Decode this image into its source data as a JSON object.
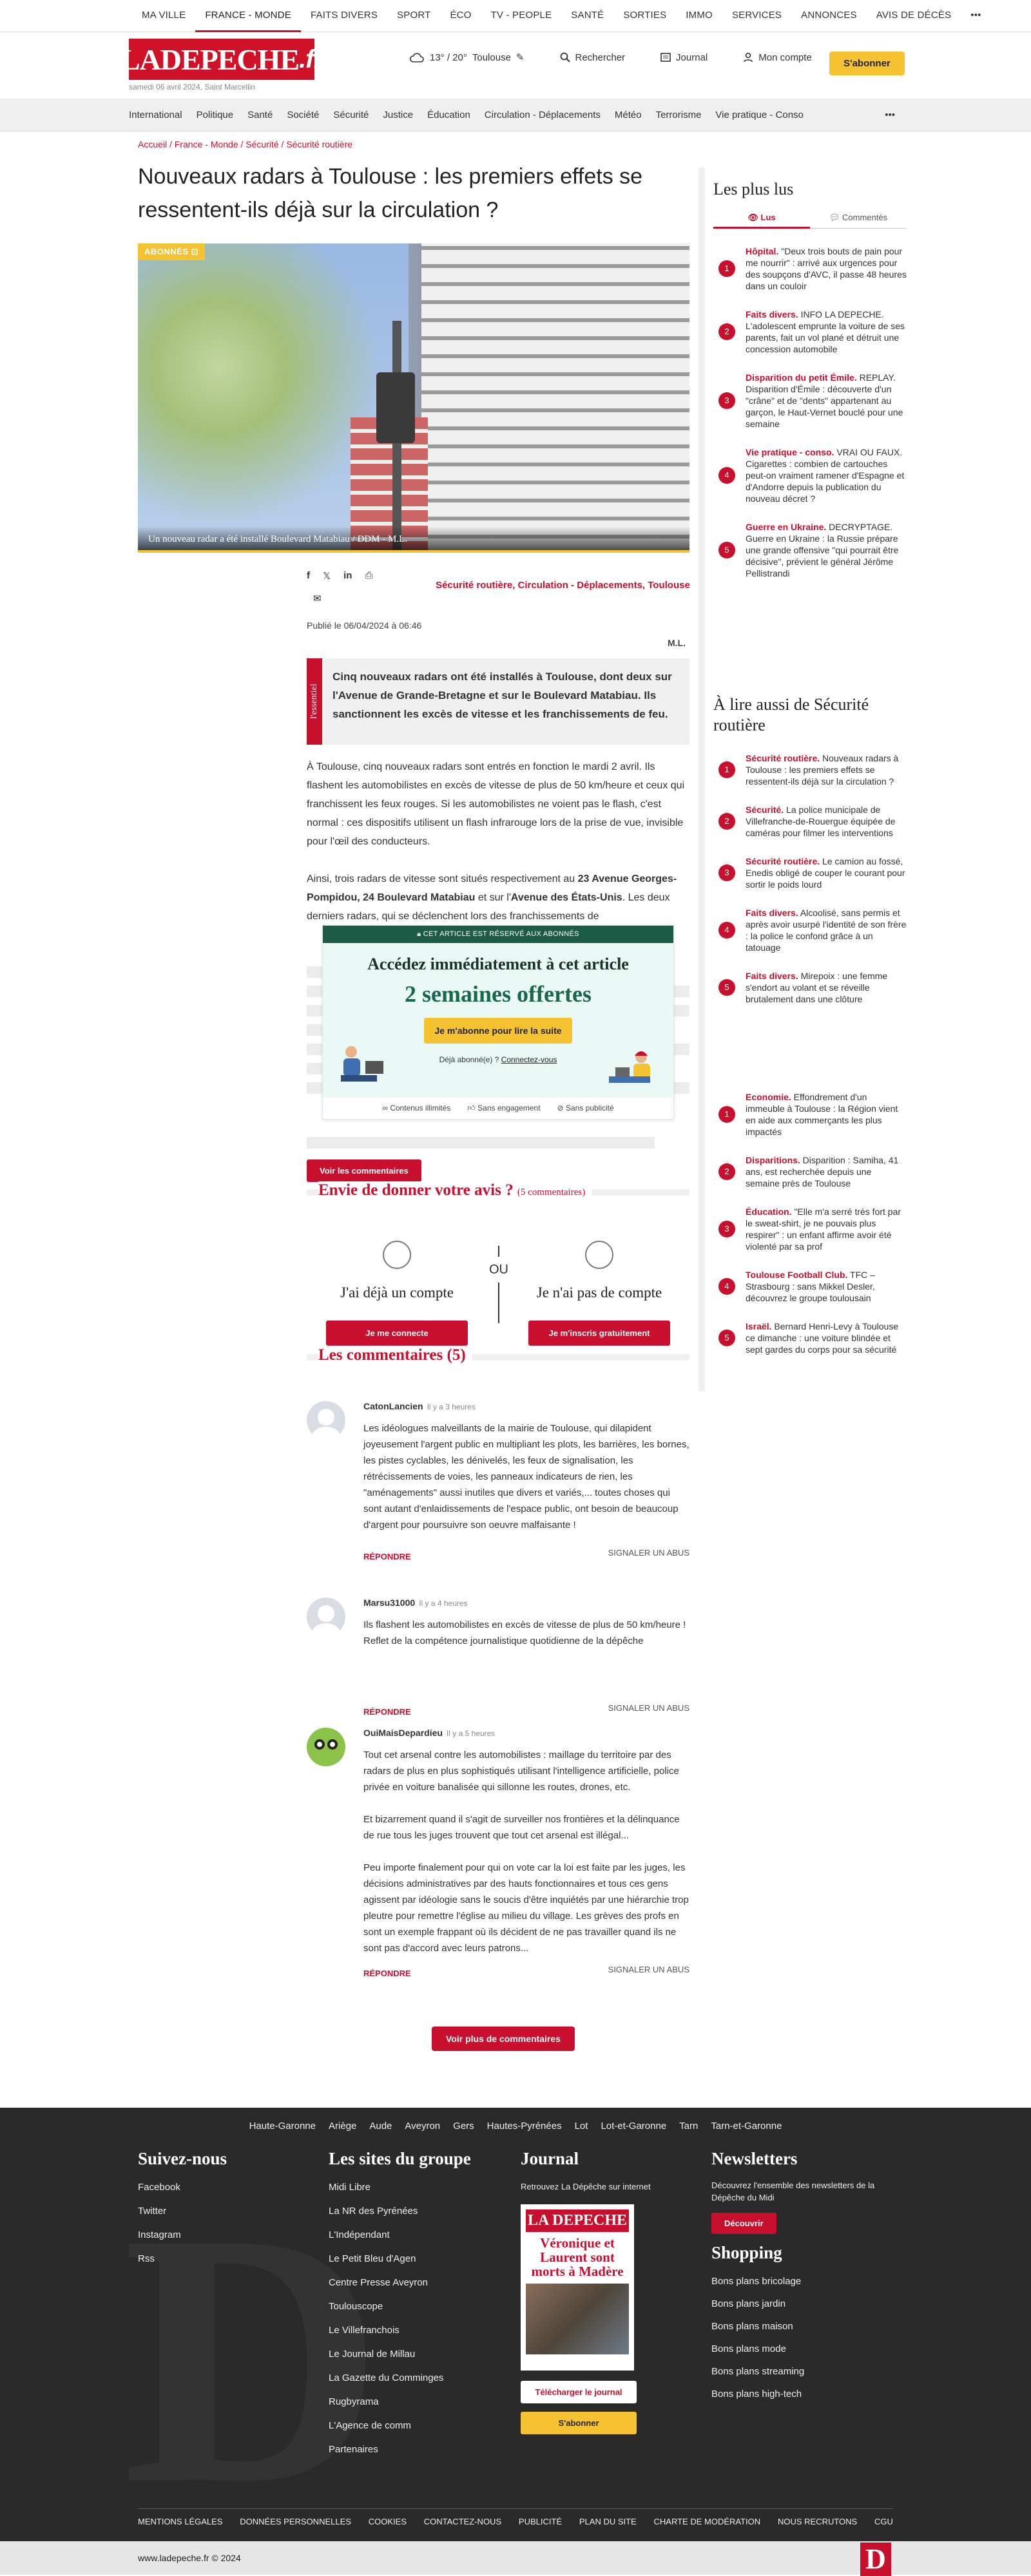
{
  "topnav": [
    "MA VILLE",
    "FRANCE - MONDE",
    "FAITS DIVERS",
    "SPORT",
    "ÉCO",
    "TV - PEOPLE",
    "SANTÉ",
    "SORTIES",
    "IMMO",
    "SERVICES",
    "ANNONCES",
    "AVIS DE DÉCÈS"
  ],
  "topnav_more": "•••",
  "header": {
    "logo_main": "LADEPECHE",
    "logo_suffix": ".fr",
    "date": "samedi 06 avril 2024, Saint Marcellin",
    "weather": "13° / 20°",
    "city": "Toulouse",
    "search": "Rechercher",
    "journal": "Journal",
    "account": "Mon compte",
    "subscribe": "S'abonner"
  },
  "catnav": [
    "International",
    "Politique",
    "Santé",
    "Société",
    "Sécurité",
    "Justice",
    "Éducation",
    "Circulation - Déplacements",
    "Météo",
    "Terrorisme",
    "Vie pratique - Conso"
  ],
  "catnav_more": "•••",
  "article": {
    "breadcrumb": "Accueil / France - Monde / Sécurité / Sécurité routière",
    "title": "Nouveaux radars à Toulouse : les premiers effets se ressentent-ils déjà sur la circulation ?",
    "badge": "ABONNÉS",
    "caption": "Un nouveau radar a été installé Boulevard Matabiau  / DDM - M.L.",
    "tags": "Sécurité routière, Circulation - Déplacements, Toulouse",
    "published": "Publié le 06/04/2024 à 06:46",
    "author": "M.L.",
    "essentiel_label": "l'essentiel",
    "essentiel": "Cinq nouveaux radars ont été installés à Toulouse, dont deux sur l'Avenue de Grande-Bretagne et sur le Boulevard Matabiau. Ils sanctionnent les excès de vitesse et les franchissements de feu.",
    "p1": "À Toulouse, cinq nouveaux radars sont entrés en fonction le mardi 2 avril. Ils flashent les automobilistes en excès de vitesse de plus de 50 km/heure et ceux qui franchissent les feux rouges. Si les automobilistes ne voient pas le flash, c'est normal : ces dispositifs utilisent un flash infrarouge lors de la prise de vue, invisible pour l'œil des conducteurs.",
    "p2_a": "Ainsi, trois radars de vitesse sont situés respectivement au ",
    "p2_b": "23 Avenue Georges-Pompidou, 24 Boulevard Matabiau",
    "p2_c": " et sur l'",
    "p2_d": "Avenue des États-Unis",
    "p2_e": ". Les deux derniers radars, qui se déclenchent lors des franchissements de"
  },
  "paywall": {
    "header": "CET ARTICLE EST RÉSERVÉ AUX ABONNÉS",
    "title": "Accédez immédiatement à cet article",
    "offer": "2 semaines offertes",
    "button": "Je m'abonne pour lire la suite",
    "already": "Déjà abonné(e) ?",
    "login": "Connectez-vous",
    "f1": "Contenus illimités",
    "f2": "Sans engagement",
    "f3": "Sans publicité"
  },
  "comments": {
    "view_button": "Voir les commentaires",
    "avis_title": "Envie de donner votre avis ?",
    "avis_count": "(5 commentaires)",
    "has_account": "J'ai déjà un compte",
    "or": "OU",
    "no_account": "Je n'ai pas de compte",
    "login_btn": "Je me connecte",
    "signup_btn": "Je m'inscris gratuitement",
    "title": "Les commentaires (5)",
    "reply": "RÉPONDRE",
    "report": "SIGNALER UN ABUS",
    "more": "Voir plus de commentaires",
    "items": [
      {
        "name": "CatonLancien",
        "time": "Il y a 3 heures",
        "text": "Les idéologues malveillants de la mairie de Toulouse, qui dilapident joyeusement l'argent public en multipliant les plots, les barrières, les bornes, les pistes cyclables, les dénivelés, les feux de signalisation, les rétrécissements de voies, les panneaux indicateurs de rien, les \"aménagements\" aussi inutiles que divers et variés,... toutes choses qui sont autant d'enlaidissements de l'espace public, ont besoin de beaucoup d'argent pour poursuivre son oeuvre malfaisante !"
      },
      {
        "name": "Marsu31000",
        "time": "Il y a 4 heures",
        "text": "Ils flashent les automobilistes en excès de vitesse de plus de 50 km/heure !\nReflet de la compétence journalistique quotidienne de la dépêche"
      },
      {
        "name": "OuiMaisDepardieu",
        "time": "Il y a 5 heures",
        "text": "Tout cet arsenal contre les automobilistes : maillage du territoire par des radars de plus en plus sophistiqués utilisant l'intelligence artificielle, police privée en voiture banalisée qui sillonne les routes, drones, etc.\n\nEt bizarrement quand il s'agit de surveiller nos frontières et la délinquance de rue tous les juges trouvent que tout cet arsenal est illégal...\n\nPeu importe finalement pour qui on vote car la loi est faite par les juges, les décisions administratives par des hauts fonctionnaires et tous ces gens agissent par idéologie sans le soucis d'être inquiétés par une hiérarchie trop pleutre pour remettre l'église au milieu du village. Les grèves des profs en sont un exemple frappant où ils décident de ne pas travailler quand ils ne sont pas d'accord avec leurs patrons..."
      }
    ]
  },
  "sidebar": {
    "plus_lus_title": "Les plus lus",
    "tab_lus": "Lus",
    "tab_com": "Commentés",
    "plus_lus": [
      {
        "cat": "Hôpital.",
        "text": " \"Deux trois bouts de pain pour me nourrir\" : arrivé aux urgences pour des soupçons d'AVC, il passe 48 heures dans un couloir"
      },
      {
        "cat": "Faits divers.",
        "text": " INFO LA DEPECHE. L'adolescent emprunte la voiture de ses parents, fait un vol plané et détruit une concession automobile"
      },
      {
        "cat": "Disparition du petit Émile.",
        "text": " REPLAY. Disparition d'Émile : découverte d'un \"crâne\" et de \"dents\" appartenant au garçon, le Haut-Vernet bouclé pour une semaine"
      },
      {
        "cat": "Vie pratique - conso.",
        "text": " VRAI OU FAUX. Cigarettes : combien de cartouches peut-on vraiment ramener d'Espagne et d'Andorre depuis la publication du nouveau décret ?"
      },
      {
        "cat": "Guerre en Ukraine.",
        "text": " DECRYPTAGE. Guerre en Ukraine : la Russie prépare une grande offensive \"qui pourrait être décisive\", prévient le général Jérôme Pellistrandi"
      }
    ],
    "alire_title": "À lire aussi de Sécurité routière",
    "alire": [
      {
        "cat": "Sécurité routière.",
        "text": " Nouveaux radars à Toulouse : les premiers effets se ressentent-ils déjà sur la circulation ?"
      },
      {
        "cat": "Sécurité.",
        "text": " La police municipale de Villefranche-de-Rouergue équipée de caméras pour filmer les interventions"
      },
      {
        "cat": "Sécurité routière.",
        "text": " Le camion au fossé, Enedis obligé de couper le courant pour sortir le poids lourd"
      },
      {
        "cat": "Faits divers.",
        "text": " Alcoolisé, sans permis et après avoir usurpé l'identité de son frère : la police le confond grâce à un tatouage"
      },
      {
        "cat": "Faits divers.",
        "text": " Mirepoix : une femme s'endort au volant et se réveille brutalement dans une clôture"
      }
    ],
    "more": [
      {
        "cat": "Economie.",
        "text": " Effondrement d'un immeuble à Toulouse : la Région vient en aide aux commerçants les plus impactés"
      },
      {
        "cat": "Disparitions.",
        "text": " Disparition : Samiha, 41 ans, est recherchée depuis une semaine près de Toulouse"
      },
      {
        "cat": "Éducation.",
        "text": " \"Elle m'a serré très fort par le sweat-shirt, je ne pouvais plus respirer\" : un enfant affirme avoir été violenté par sa prof"
      },
      {
        "cat": "Toulouse Football Club.",
        "text": " TFC – Strasbourg : sans Mikkel Desler, découvrez le groupe toulousain"
      },
      {
        "cat": "Israël.",
        "text": " Bernard Henri-Levy à Toulouse ce dimanche : une voiture blindée et sept gardes du corps pour sa sécurité"
      }
    ]
  },
  "footer": {
    "depts": [
      "Haute-Garonne",
      "Ariège",
      "Aude",
      "Aveyron",
      "Gers",
      "Hautes-Pyrénées",
      "Lot",
      "Lot-et-Garonne",
      "Tarn",
      "Tarn-et-Garonne"
    ],
    "suivez_title": "Suivez-nous",
    "suivez": [
      "Facebook",
      "Twitter",
      "Instagram",
      "Rss"
    ],
    "sites_title": "Les sites du groupe",
    "sites": [
      "Midi Libre",
      "La NR des Pyrénées",
      "L'Indépendant",
      "Le Petit Bleu d'Agen",
      "Centre Presse Aveyron",
      "Toulouscope",
      "Le Villefranchois",
      "Le Journal de Millau",
      "La Gazette du Comminges",
      "Rugbyrama",
      "L'Agence de comm",
      "Partenaires"
    ],
    "journal_title": "Journal",
    "journal_text": "Retrouvez La Dépêche sur internet",
    "journal_logo": "LA DEPECHE",
    "journal_headline": "Véronique et Laurent sont morts à Madère",
    "journal_dl": "Télécharger le journal",
    "journal_sub": "S'abonner",
    "news_title": "Newsletters",
    "news_text": "Découvrez l'ensemble des newsletters de la Dépêche du Midi",
    "news_btn": "Découvrir",
    "shop_title": "Shopping",
    "shop": [
      "Bons plans bricolage",
      "Bons plans jardin",
      "Bons plans maison",
      "Bons plans mode",
      "Bons plans streaming",
      "Bons plans high-tech"
    ],
    "legal": [
      "MENTIONS LÉGALES",
      "DONNÉES PERSONNELLES",
      "COOKIES",
      "CONTACTEZ-NOUS",
      "PUBLICITÉ",
      "PLAN DU SITE",
      "CHARTE DE MODÉRATION",
      "NOUS RECRUTONS",
      "CGU"
    ],
    "copyright": "www.ladepeche.fr © 2024",
    "d_logo": "D"
  }
}
